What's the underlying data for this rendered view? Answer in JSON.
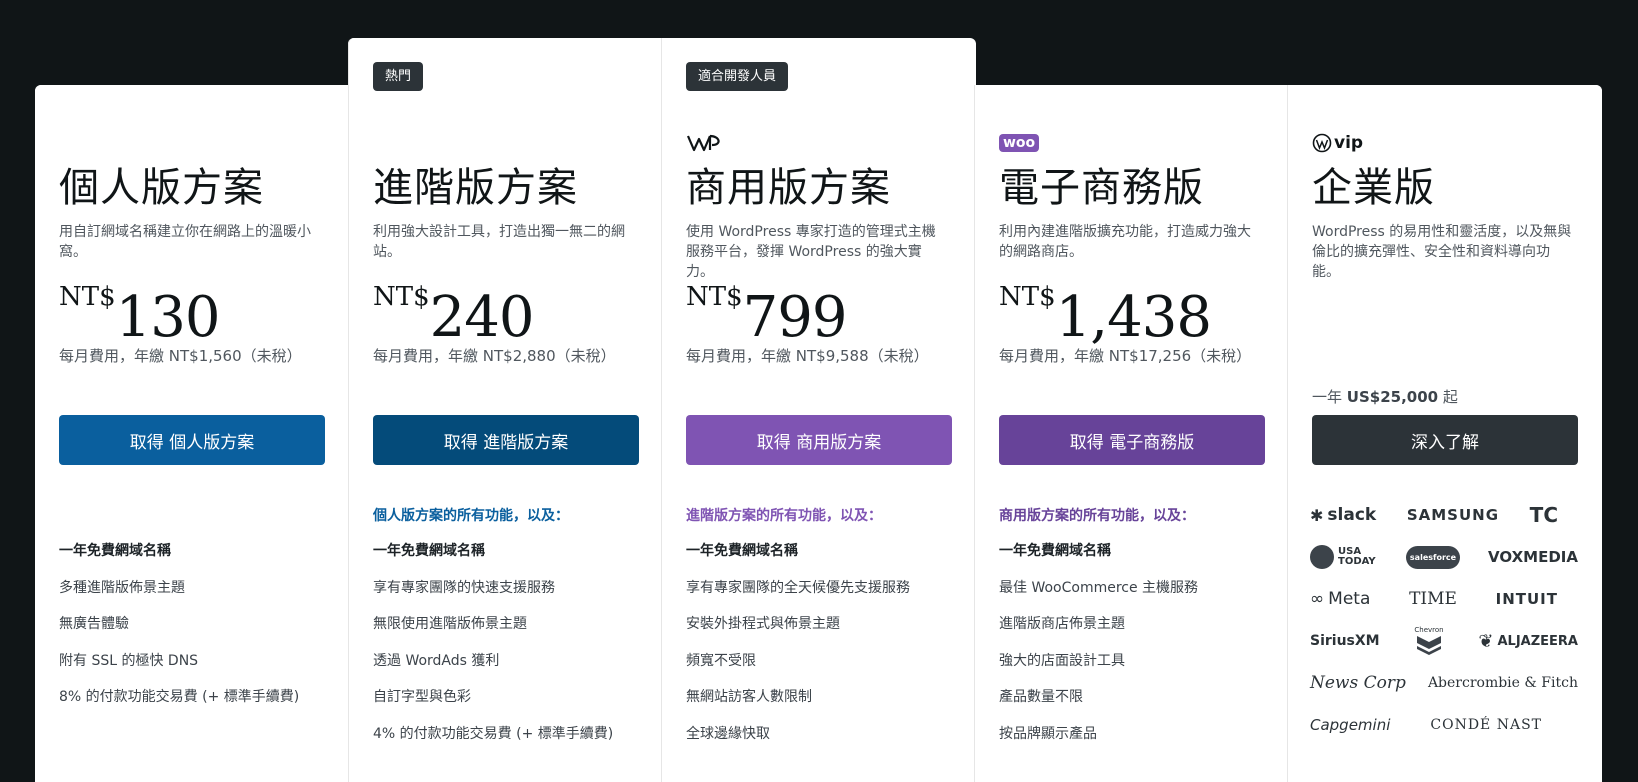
{
  "plans": [
    {
      "title": "個人版方案",
      "description": "用自訂網域名稱建立你在網路上的溫暖小窩。",
      "currency": "NT$",
      "price": "130",
      "billing": "每月費用，年繳 NT$1,560（未稅）",
      "cta": "取得 個人版方案",
      "cta_color": "#0a5f9e",
      "features": [
        "一年免費網域名稱",
        "多種進階版佈景主題",
        "無廣告體驗",
        "附有 SSL 的極快 DNS",
        "8% 的付款功能交易費 (+ 標準手續費)"
      ]
    },
    {
      "badge": "熱門",
      "title": "進階版方案",
      "description": "利用強大設計工具，打造出獨一無二的網站。",
      "currency": "NT$",
      "price": "240",
      "billing": "每月費用，年繳 NT$2,880（未稅）",
      "cta": "取得 進階版方案",
      "cta_color": "#044b7a",
      "features_heading": "個人版方案的所有功能，以及：",
      "features_heading_color": "#0a5f9e",
      "features": [
        "一年免費網域名稱",
        "享有專家團隊的快速支援服務",
        "無限使用進階版佈景主題",
        "透過 WordAds 獲利",
        "自訂字型與色彩",
        "4% 的付款功能交易費 (+ 標準手續費)"
      ]
    },
    {
      "badge": "適合開發人員",
      "logo": "wp-cloud-logo",
      "title": "商用版方案",
      "description": "使用 WordPress 專家打造的管理式主機服務平台，發揮 WordPress 的強大實力。",
      "currency": "NT$",
      "price": "799",
      "billing": "每月費用，年繳 NT$9,588（未稅）",
      "cta": "取得 商用版方案",
      "cta_color": "#7f54b3",
      "features_heading": "進階版方案的所有功能，以及：",
      "features_heading_color": "#7f54b3",
      "features": [
        "一年免費網域名稱",
        "享有專家團隊的全天候優先支援服務",
        "安裝外掛程式與佈景主題",
        "頻寬不受限",
        "無網站訪客人數限制",
        "全球邊緣快取"
      ]
    },
    {
      "logo": "woo-logo",
      "logo_text": "woo",
      "title": "電子商務版",
      "description": "利用內建進階版擴充功能，打造威力強大的網路商店。",
      "currency": "NT$",
      "price": "1,438",
      "billing": "每月費用，年繳 NT$17,256（未稅）",
      "cta": "取得 電子商務版",
      "cta_color": "#674399",
      "features_heading": "商用版方案的所有功能，以及：",
      "features_heading_color": "#674399",
      "features": [
        "一年免費網域名稱",
        "最佳 WooCommerce 主機服務",
        "進階版商店佈景主題",
        "強大的店面設計工具",
        "產品數量不限",
        "按品牌顯示產品"
      ]
    },
    {
      "logo": "wp-vip-logo",
      "logo_text": "vip",
      "title": "企業版",
      "description": "WordPress 的易用性和靈活度，以及無與倫比的擴充彈性、安全性和資料導向功能。",
      "billing_prefix": "一年 ",
      "billing_amount": "US$25,000",
      "billing_suffix": " 起",
      "cta": "深入了解",
      "cta_color": "#2c3338",
      "brands": [
        [
          "slack",
          "SAMSUNG",
          "TC"
        ],
        [
          "USA TODAY",
          "salesforce",
          "VOXMEDIA"
        ],
        [
          "Meta",
          "TIME",
          "INTUIT"
        ],
        [
          "SiriusXM",
          "Chevron",
          "ALJAZEERA"
        ],
        [
          "News Corp",
          "Abercrombie & Fitch"
        ],
        [
          "Capgemini",
          "CONDÉ NAST"
        ]
      ]
    }
  ]
}
